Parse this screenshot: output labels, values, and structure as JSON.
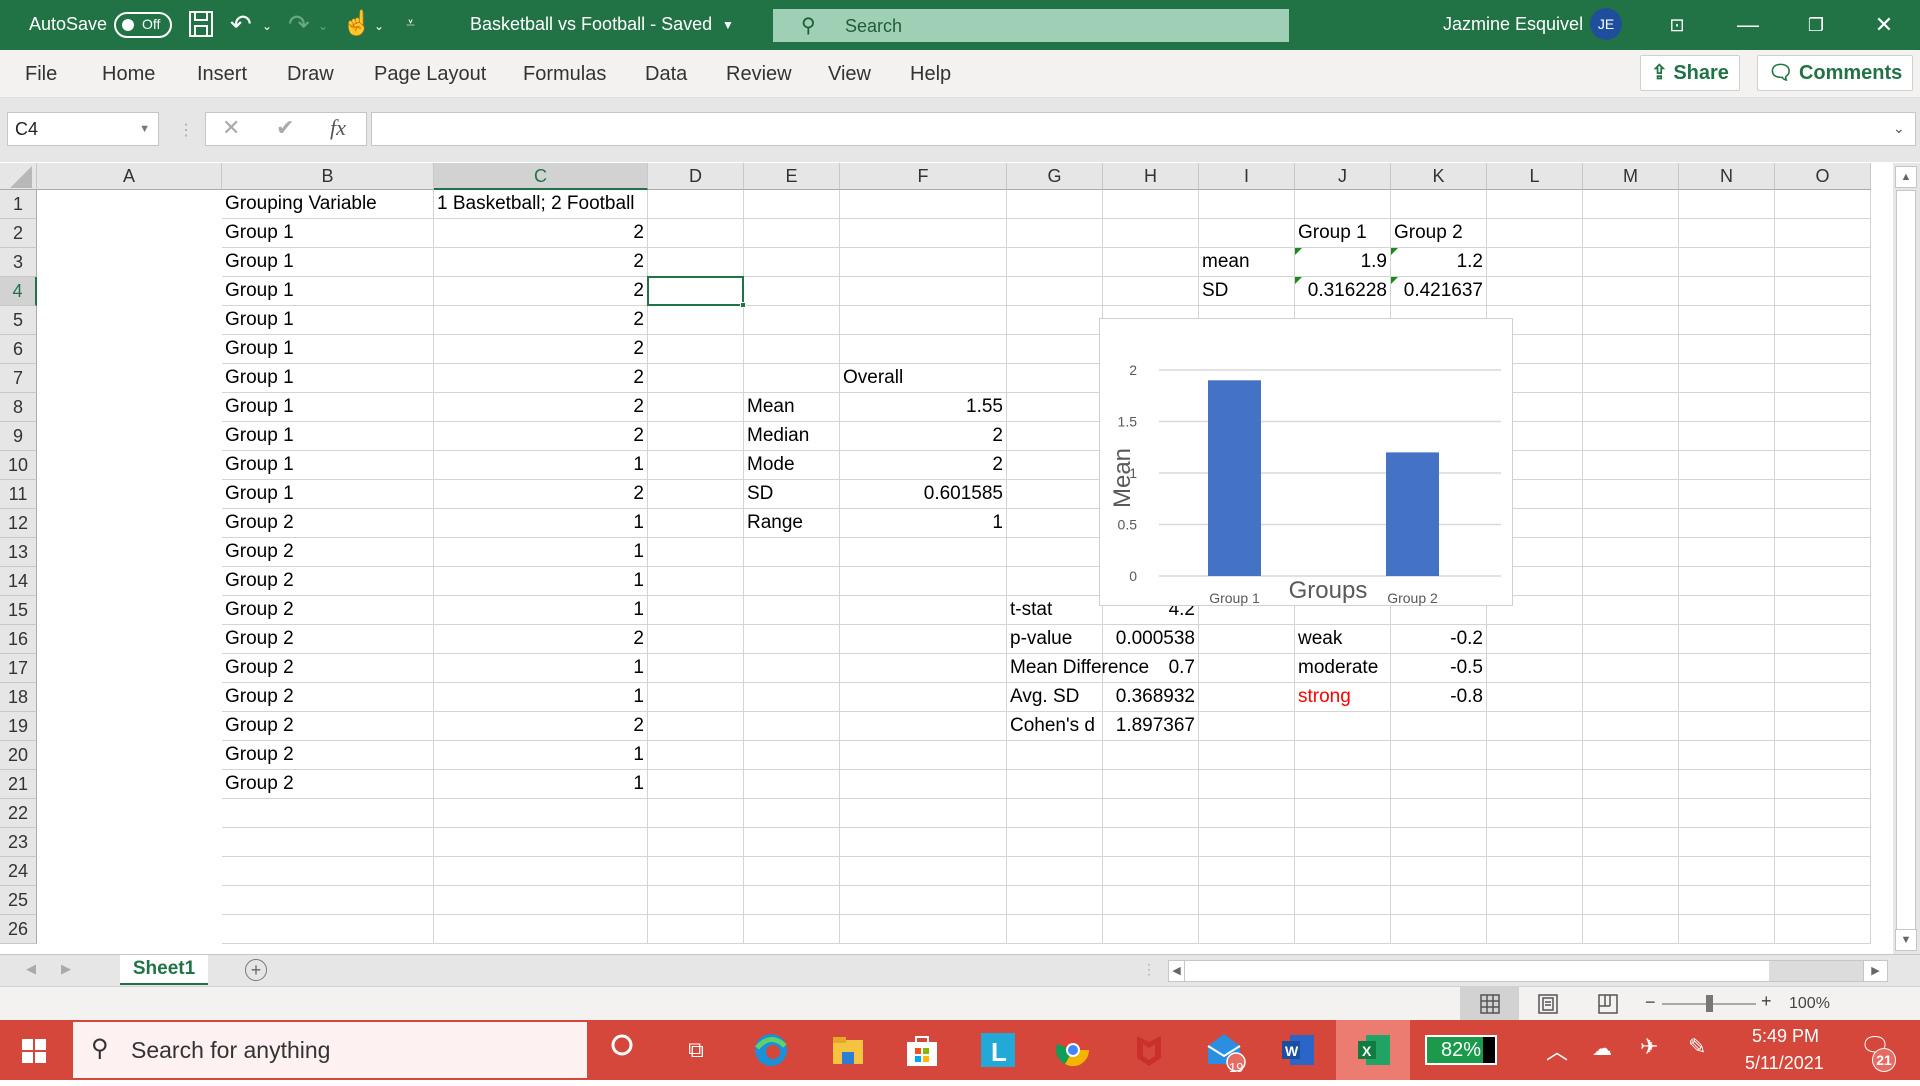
{
  "titlebar": {
    "autosave_label": "AutoSave",
    "autosave_state": "Off",
    "doc_title": "Basketball vs Football  -  Saved",
    "search_placeholder": "Search",
    "user_name": "Jazmine Esquivel",
    "user_initials": "JE"
  },
  "ribbon": {
    "tabs": [
      "File",
      "Home",
      "Insert",
      "Draw",
      "Page Layout",
      "Formulas",
      "Data",
      "Review",
      "View",
      "Help"
    ],
    "share_label": "Share",
    "comments_label": "Comments"
  },
  "formula_bar": {
    "name_box": "C4",
    "fx_label": "fx",
    "formula": ""
  },
  "sheet": {
    "columns": [
      "A",
      "B",
      "C",
      "D",
      "E",
      "F",
      "G",
      "H",
      "I",
      "J",
      "K",
      "L",
      "M",
      "N",
      "O"
    ],
    "selected_column": "C",
    "selected_row": 4,
    "selected_cell": "C4",
    "rows": [
      "1",
      "2",
      "3",
      "4",
      "5",
      "6",
      "7",
      "8",
      "9",
      "10",
      "11",
      "12",
      "13",
      "14",
      "15",
      "16",
      "17",
      "18",
      "19",
      "20",
      "21",
      "22",
      "23",
      "24",
      "25",
      "26"
    ],
    "colA": [
      "Grouping Variable",
      "Group 1",
      "Group 1",
      "Group 1",
      "Group 1",
      "Group 1",
      "Group 1",
      "Group 1",
      "Group 1",
      "Group 1",
      "Group 1",
      "Group 2",
      "Group 2",
      "Group 2",
      "Group 2",
      "Group 2",
      "Group 2",
      "Group 2",
      "Group 2",
      "Group 2",
      "Group 2"
    ],
    "colB": [
      "1 Basketball; 2 Football",
      "2",
      "2",
      "2",
      "2",
      "2",
      "2",
      "2",
      "2",
      "1",
      "2",
      "1",
      "1",
      "1",
      "1",
      "2",
      "1",
      "1",
      "2",
      "1",
      "1"
    ],
    "overall": {
      "header": "Overall",
      "labels": [
        "Mean",
        "Median",
        "Mode",
        "SD",
        "Range"
      ],
      "values": [
        "1.55",
        "2",
        "2",
        "0.601585",
        "1"
      ]
    },
    "group_stats": {
      "headers": [
        "Group 1",
        "Group 2"
      ],
      "mean_label": "mean",
      "sd_label": "SD",
      "means": [
        "1.9",
        "1.2"
      ],
      "sds": [
        "0.316228",
        "0.421637"
      ]
    },
    "ttest": {
      "labels": [
        "t-stat",
        "p-value",
        "Mean Difference",
        "Avg. SD",
        "Cohen's d"
      ],
      "values": [
        "4.2",
        "0.000538",
        "0.7",
        "0.368932",
        "1.897367"
      ]
    },
    "effect_sizes": {
      "labels": [
        "weak",
        "moderate",
        "strong"
      ],
      "values": [
        "-0.2",
        "-0.5",
        "-0.8"
      ],
      "highlight_color": "#ff0000"
    }
  },
  "chart_data": {
    "type": "bar",
    "title": "",
    "categories": [
      "Group 1",
      "Group 2"
    ],
    "values": [
      1.9,
      1.2
    ],
    "xlabel": "Groups",
    "ylabel": "Mean",
    "ylim": [
      0,
      2
    ],
    "yticks": [
      "0",
      "0.5",
      "1",
      "1.5",
      "2"
    ],
    "grid": true,
    "bar_color": "#4472c4",
    "legend": "none"
  },
  "sheet_tabs": {
    "tabs": [
      "Sheet1"
    ],
    "active": "Sheet1"
  },
  "statusbar": {
    "zoom": "100%",
    "zoom_percent": 100
  },
  "taskbar": {
    "search_placeholder": "Search for anything",
    "battery": "82%",
    "time": "5:49 PM",
    "date": "5/11/2021",
    "mail_badge": "19",
    "notification_badge": "21",
    "apps": [
      "cortana",
      "task-view",
      "edge",
      "file-explorer",
      "microsoft-store",
      "l-app",
      "chrome",
      "mcafee",
      "mail",
      "word",
      "excel"
    ]
  },
  "colors": {
    "excel_green": "#217346",
    "taskbar_red": "#d5473a"
  }
}
